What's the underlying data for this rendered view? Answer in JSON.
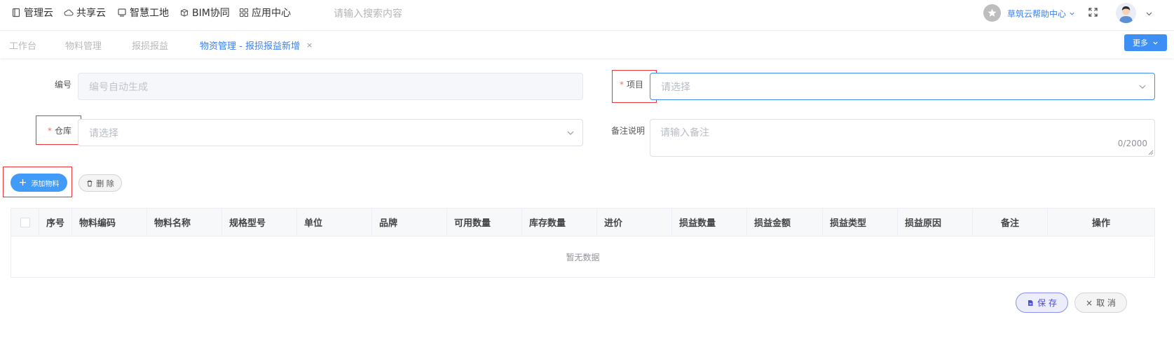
{
  "topnav": {
    "items": [
      {
        "label": "管理云",
        "icon": "document-icon"
      },
      {
        "label": "共享云",
        "icon": "cloud-icon"
      },
      {
        "label": "智慧工地",
        "icon": "screen-icon"
      },
      {
        "label": "BIM协同",
        "icon": "cube-icon"
      },
      {
        "label": "应用中心",
        "icon": "apps-grid-icon"
      }
    ],
    "search_placeholder": "请输入搜索内容",
    "help_label": "草筑云帮助中心"
  },
  "tabs": [
    {
      "label": "工作台"
    },
    {
      "label": "物料管理"
    },
    {
      "label": "报损报益"
    },
    {
      "label": "物资管理 - 报损报益新增",
      "close": "×"
    }
  ],
  "more_label": "更多",
  "form": {
    "number": {
      "label": "编号",
      "placeholder": "编号自动生成"
    },
    "project": {
      "label": "项目",
      "required_mark": "*",
      "placeholder": "请选择"
    },
    "warehouse": {
      "label": "仓库",
      "required_mark": "*",
      "placeholder": "请选择"
    },
    "remark": {
      "label": "备注说明",
      "placeholder": "请输入备注",
      "counter": "0/2000"
    }
  },
  "actions": {
    "add_label": "添加物料",
    "add_icon": "+",
    "delete_label": "删 除"
  },
  "table": {
    "columns": [
      "序号",
      "物料编码",
      "物料名称",
      "规格型号",
      "单位",
      "品牌",
      "可用数量",
      "库存数量",
      "进价",
      "损益数量",
      "损益金额",
      "损益类型",
      "损益原因",
      "备注",
      "操作"
    ],
    "empty_text": "暂无数据"
  },
  "footer": {
    "save_label": "保 存",
    "cancel_label": "取 消",
    "cancel_icon": "×"
  },
  "colors": {
    "primary": "#3d8ff5",
    "link": "#3d7ff2",
    "required": "#f56c6c",
    "highlight_box": "#e8363a"
  }
}
